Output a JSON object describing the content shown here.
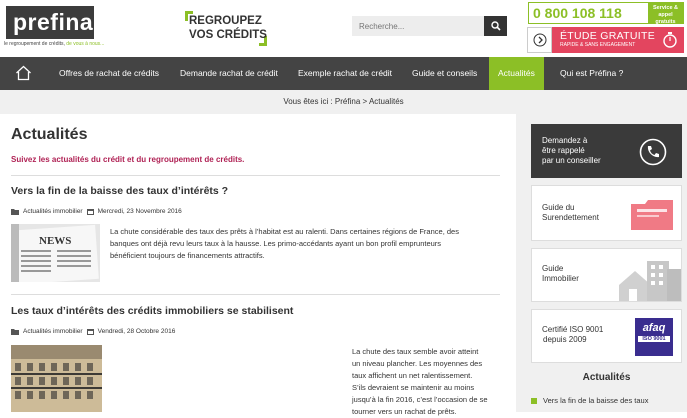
{
  "header": {
    "logo_text": "prefina",
    "logo_sub_1": "le regroupement de crédits,",
    "logo_sub_2": "de vous à nous...",
    "slogan_line1": "REGROUPEZ",
    "slogan_line2": "VOS CRÉDITS",
    "search_placeholder": "Recherche...",
    "phone_number": "0 800 108 118",
    "phone_tag_1": "Service & appel",
    "phone_tag_2": "gratuits",
    "etude_title": "ÉTUDE GRATUITE",
    "etude_sub": "RAPIDE & SANS ENGAGEMENT"
  },
  "nav": {
    "items": [
      {
        "label": "Offres de rachat de crédits"
      },
      {
        "label": "Demande rachat de crédit"
      },
      {
        "label": "Exemple rachat de crédit"
      },
      {
        "label": "Guide et conseils"
      },
      {
        "label": "Actualités"
      },
      {
        "label": "Qui est Préfina ?"
      }
    ],
    "active_index": 4
  },
  "breadcrumb": {
    "prefix": "Vous êtes ici :",
    "home": "Préfina",
    "sep": ">",
    "current": "Actualités"
  },
  "page": {
    "title": "Actualités",
    "intro": "Suivez les actualités du crédit et du regroupement de crédits."
  },
  "articles": [
    {
      "title": "Vers la fin de la baisse des taux d’intérêts ?",
      "category": "Actualités immobilier",
      "date": "Mercredi, 23 Novembre 2016",
      "excerpt_lines": [
        "La chute considérable des taux des prêts à l’habitat est au ralenti. Dans certaines régions de France, des",
        "banques ont déjà revu leurs taux à la hausse. Les primo-accédants ayant un bon profil emprunteurs",
        "bénéficient toujours de financements attractifs."
      ],
      "thumb_text": "NEWS"
    },
    {
      "title": "Les taux d’intérêts des crédits immobiliers se stabilisent",
      "category": "Actualités immobilier",
      "date": "Vendredi, 28 Octobre 2016",
      "excerpt_lines": [
        "La chute des taux semble avoir atteint",
        "un niveau plancher. Les moyennes des",
        "taux affichent un net ralentissement.",
        "S’ils devraient se maintenir au moins",
        "jusqu’à la fin 2016, c’est l’occasion de se",
        "tourner vers un rachat de prêts."
      ]
    }
  ],
  "sidebar": {
    "callback_lines": [
      "Demandez à",
      "être rappelé",
      "par un conseiller"
    ],
    "surendettement_lines": [
      "Guide du",
      "Surendettement"
    ],
    "immobilier_lines": [
      "Guide",
      "Immobilier"
    ],
    "iso_lines": [
      "Certifié ISO 9001",
      "depuis 2009"
    ],
    "afaq_text": "afaq",
    "afaq_sub": "ISO 9001",
    "news_heading": "Actualités",
    "news_first": "Vers la fin de la baisse des taux"
  },
  "colors": {
    "accent_green": "#8cbf26",
    "dark": "#444444",
    "intro_red": "#b02255",
    "etude_pink": "#e3455f"
  }
}
